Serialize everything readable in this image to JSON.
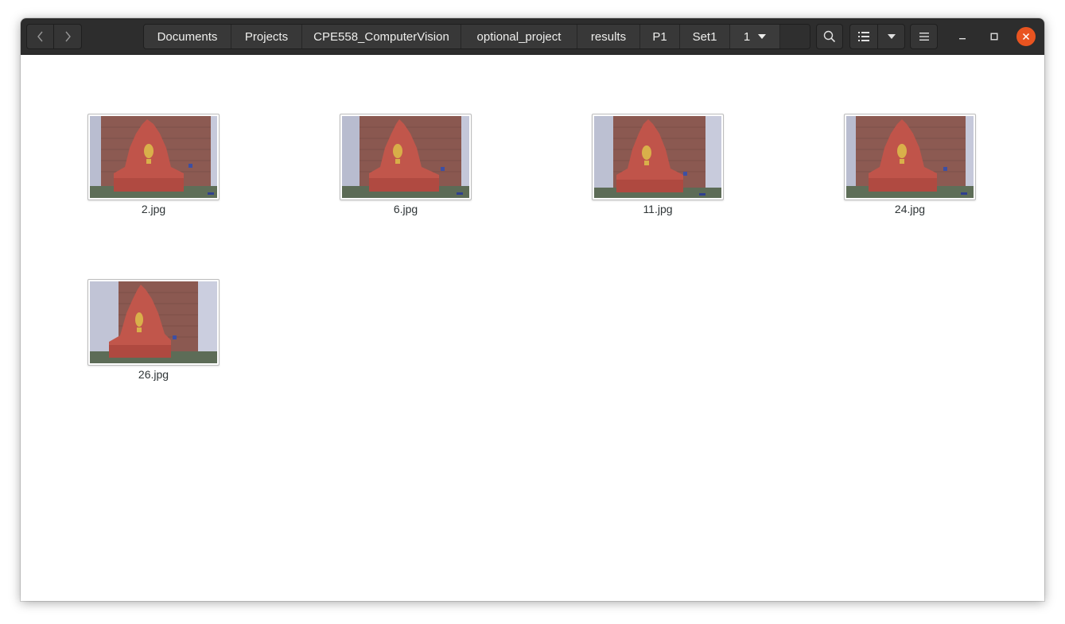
{
  "window": {
    "title": "Set1"
  },
  "headerbar": {
    "back_icon": "chevron-left-icon",
    "forward_icon": "chevron-right-icon",
    "breadcrumbs": [
      {
        "label": "Documents"
      },
      {
        "label": "Projects"
      },
      {
        "label": "CPE558_ComputerVision"
      },
      {
        "label": "optional_project"
      },
      {
        "label": "results"
      },
      {
        "label": "P1"
      },
      {
        "label": "Set1"
      },
      {
        "label": "1"
      }
    ],
    "search_icon": "search-icon",
    "view_icon": "list-view-icon",
    "view_options_icon": "chevron-down-icon",
    "menu_icon": "hamburger-menu-icon",
    "accent_close": "#e95420"
  },
  "files": [
    {
      "name": "2.jpg",
      "thumbnail": "fountain-photo"
    },
    {
      "name": "6.jpg",
      "thumbnail": "fountain-photo"
    },
    {
      "name": "11.jpg",
      "thumbnail": "fountain-photo"
    },
    {
      "name": "24.jpg",
      "thumbnail": "fountain-photo"
    },
    {
      "name": "26.jpg",
      "thumbnail": "fountain-photo"
    }
  ]
}
